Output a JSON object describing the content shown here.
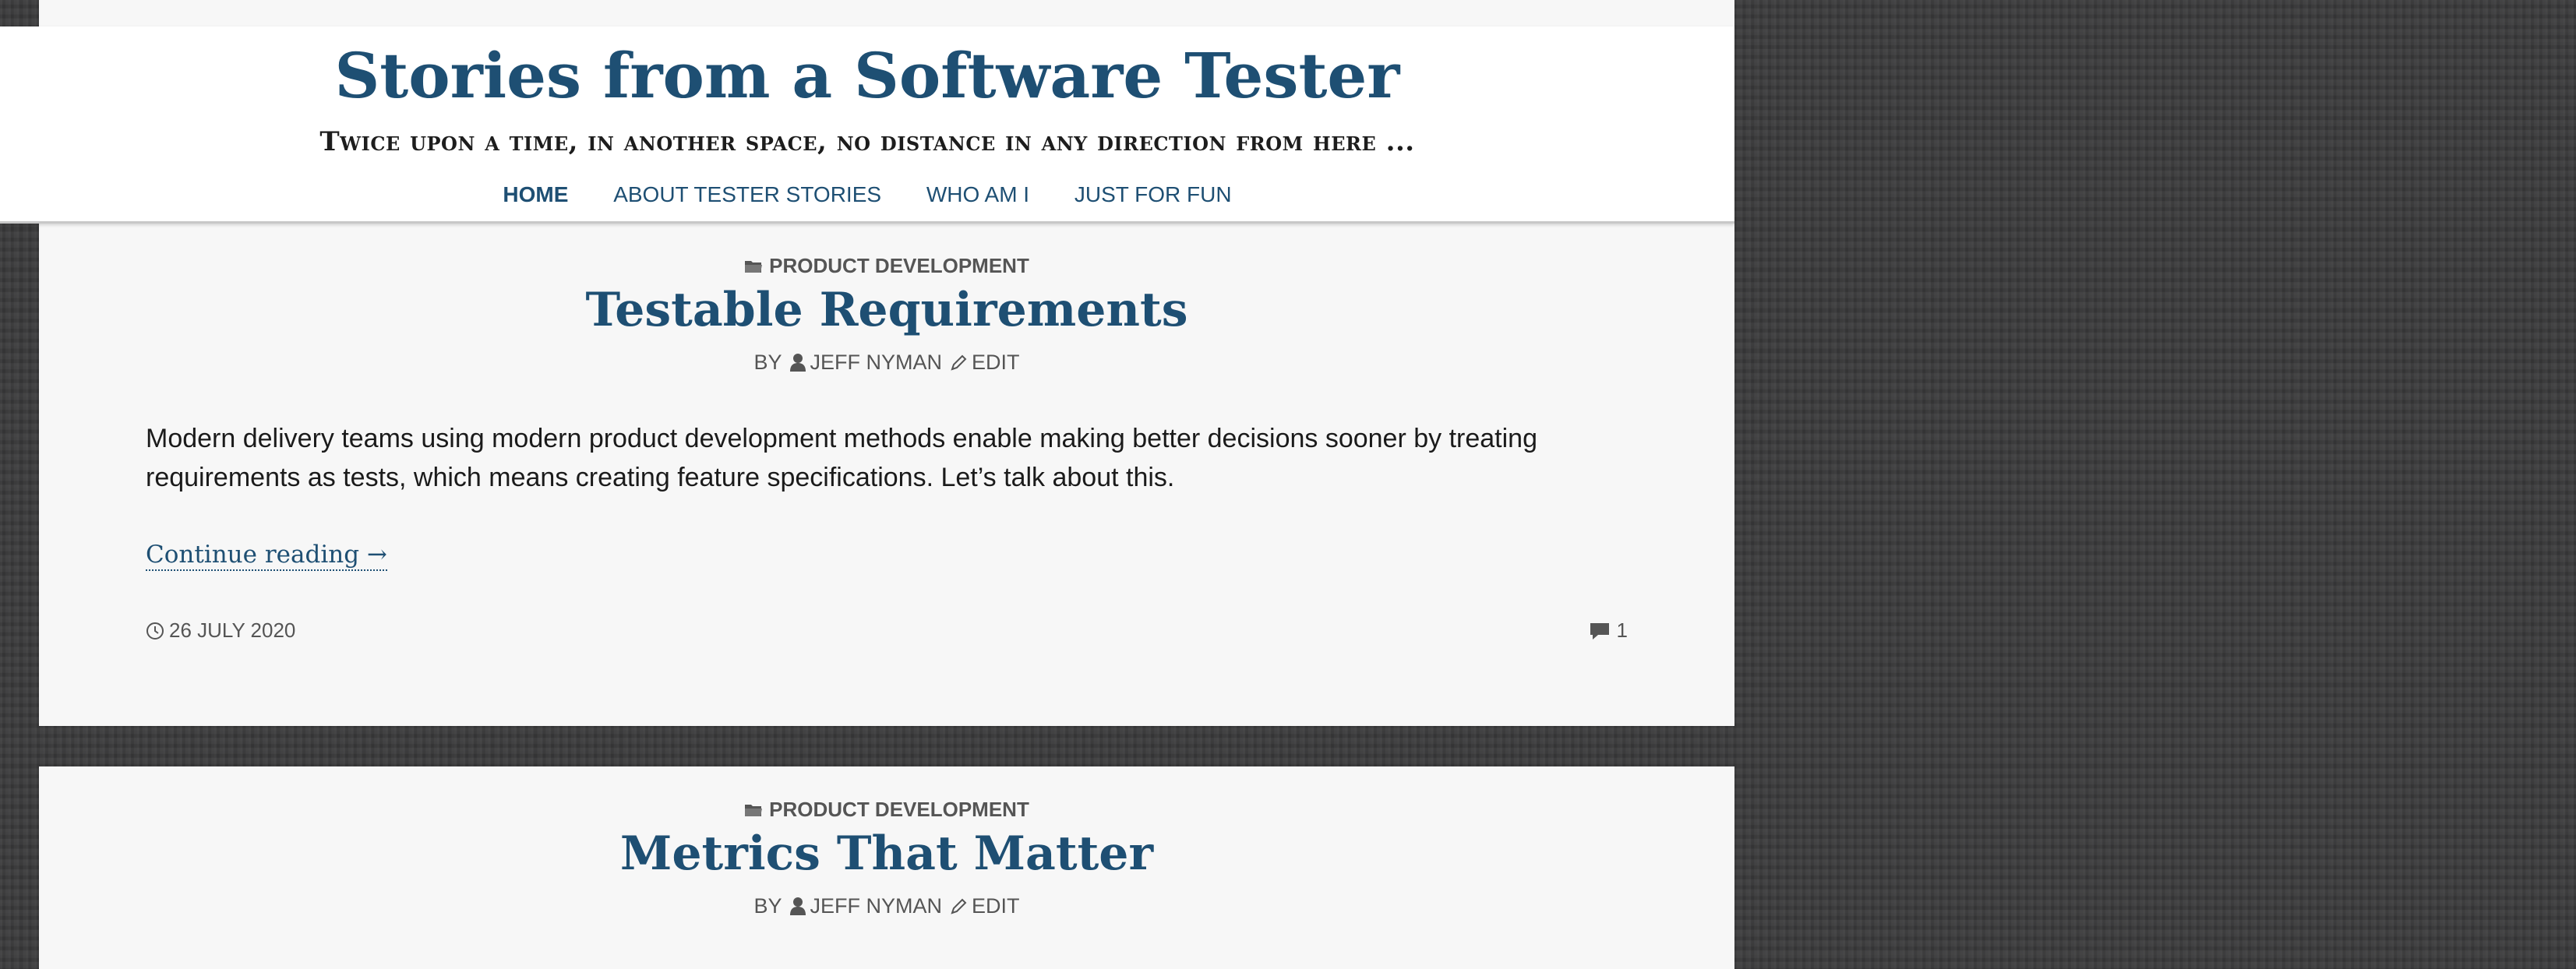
{
  "site": {
    "title": "Stories from a Software Tester",
    "tagline": "Twice upon a time, in another space, no distance in any direction from here ..."
  },
  "nav": [
    {
      "label": "HOME",
      "current": true
    },
    {
      "label": "ABOUT TESTER STORIES",
      "current": false
    },
    {
      "label": "WHO AM I",
      "current": false
    },
    {
      "label": "JUST FOR FUN",
      "current": false
    }
  ],
  "posts": [
    {
      "category": "PRODUCT DEVELOPMENT",
      "title": "Testable Requirements",
      "by": "BY",
      "author": "JEFF NYMAN",
      "edit": "EDIT",
      "excerpt": "Modern delivery teams using modern product development methods enable making better decisions sooner by treating requirements as tests, which means creating feature specifications. Let’s talk about this.",
      "continue": "Continue reading →",
      "date": "26 JULY 2020",
      "comments": "1"
    },
    {
      "category": "PRODUCT DEVELOPMENT",
      "title": "Metrics That Matter",
      "by": "BY",
      "author": "JEFF NYMAN",
      "edit": "EDIT"
    }
  ],
  "icons": {
    "category": "folder-icon",
    "author": "user-icon",
    "edit": "pencil-icon",
    "date": "clock-icon",
    "comments": "comment-icon"
  },
  "colors": {
    "accent": "#1e4f73",
    "text": "#1b1b1b",
    "meta": "#555555",
    "card": "#f7f7f7",
    "background": "#3a3a3b"
  }
}
